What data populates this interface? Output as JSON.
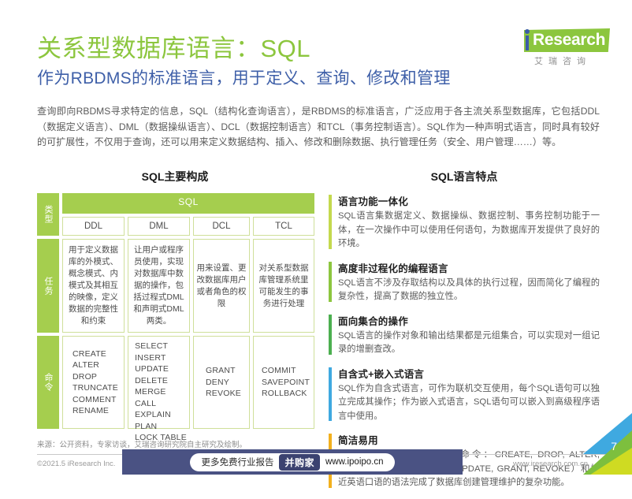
{
  "header": {
    "title": "关系型数据库语言：SQL",
    "subtitle": "作为RBDMS的标准语言，用于定义、查询、修改和管理",
    "title_color": "#8cc63e",
    "subtitle_color": "#3e5fa8"
  },
  "logo": {
    "word": "Research",
    "cn": "艾瑞咨询",
    "green": "#8cc63e",
    "blue": "#3b5ca8"
  },
  "intro": "查询即向RBDMS寻求特定的信息，SQL（结构化查询语言），是RBDMS的标准语言，广泛应用于各主流关系型数据库，它包括DDL（数据定义语言）、DML（数据操纵语言）、DCL（数据控制语言）和TCL（事务控制语言）。SQL作为一种声明式语言，同时具有较好的可扩展性，不仅用于查询，还可以用来定义数据结构、插入、修改和删除数据、执行管理任务（安全、用户管理……）等。",
  "left_panel": {
    "heading": "SQL主要构成",
    "sql_banner": "SQL",
    "row_labels": {
      "type": "类型",
      "task": "任务",
      "command": "命令"
    },
    "types": [
      "DDL",
      "DML",
      "DCL",
      "TCL"
    ],
    "tasks": [
      "用于定义数据库的外模式、概念模式、内模式及其相互的映像，定义数据的完整性和约束",
      "让用户或程序员使用，实现对数据库中数据的操作，包括过程式DML和声明式DML两类。",
      "用来设置、更改数据库用户或者角色的权限",
      "对关系型数据库管理系统里可能发生的事务进行处理"
    ],
    "commands": [
      "CREATE\nALTER\nDROP\nTRUNCATE\nCOMMENT\nRENAME",
      "SELECT\nINSERT\nUPDATE\nDELETE\nMERGE\nCALL\nEXPLAIN\nPLAN\nLOCK TABLE",
      "GRANT\nDENY\nREVOKE",
      "COMMIT\nSAVEPOINT\nROLLBACK"
    ]
  },
  "right_panel": {
    "heading": "SQL语言特点",
    "features": [
      {
        "title": "语言功能一体化",
        "body": "SQL语言集数据定义、数据操纵、数据控制、事务控制功能于一体，在一次操作中可以使用任何语句，为数据库开发提供了良好的环境。",
        "color": "#c4d94e"
      },
      {
        "title": "高度非过程化的编程语言",
        "body": "SQL语言不涉及存取结构以及具体的执行过程，因而简化了编程的复杂性，提高了数据的独立性。",
        "color": "#8dc63f"
      },
      {
        "title": "面向集合的操作",
        "body": "SQL语言的操作对象和输出结果都是元组集合，可以实现对一组记录的增删查改。",
        "color": "#4caf50"
      },
      {
        "title": "自含式+嵌入式语言",
        "body": "SQL作为自含式语言，可作为联机交互使用，每个SQL语句可以独立完成其操作；作为嵌入式语言，SQL语句可以嵌入到高级程序语言中使用。",
        "color": "#3fa9e0"
      },
      {
        "title": "简洁易用",
        "body": "SQL用简单的语句（核心命令：CREATE, DROP, ALTER, SELECT, DELETE, INSERT, UPDATE, GRANT, REVOKE）和接近英语口语的语法完成了数据库创建管理维护的复杂功能。",
        "color": "#f2b01e"
      }
    ]
  },
  "source": "来源：公开资料，专家访谈，艾瑞咨询研究院自主研究及绘制。",
  "footer": {
    "left": "©2021.5 iResearch Inc.",
    "right": "www.iresearch.com.cn",
    "page": "7"
  },
  "watermark": {
    "text": "更多免费行业报告",
    "badge": "并购家",
    "url": "www.ipoipo.cn",
    "bg": "#4a5283"
  }
}
